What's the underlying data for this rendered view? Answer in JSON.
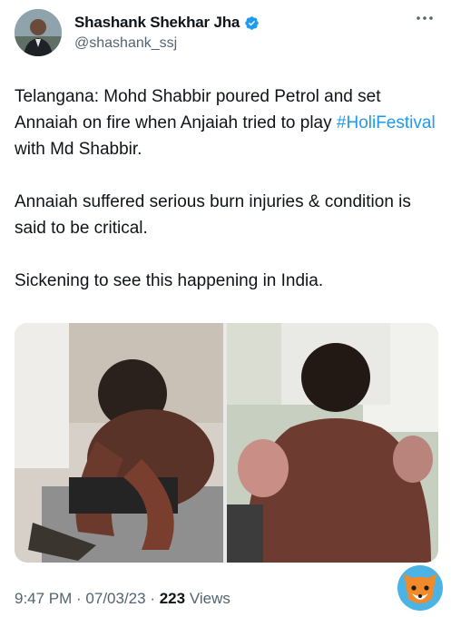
{
  "author": {
    "display_name": "Shashank Shekhar Jha",
    "handle": "@shashank_ssj",
    "avatar_icon": "profile-avatar",
    "verified_icon": "verified-badge-icon",
    "verified_color": "#1d9bf0"
  },
  "more_icon": "more-dots-icon",
  "tweet": {
    "line1_prefix": "Telangana: Mohd Shabbir poured Petrol and set Annaiah on fire when Anjaiah tried to play ",
    "hashtag": "#HoliFestival",
    "line1_suffix": " with Md Shabbir.",
    "paragraph2": "Annaiah suffered serious burn injuries & condition is said to be critical.",
    "paragraph3": "Sickening to see this happening in India."
  },
  "meta": {
    "time": "9:47 PM",
    "separator": " · ",
    "date": "07/03/23",
    "views_count": "223",
    "views_label": " Views"
  },
  "colors": {
    "link": "#1d9bf0",
    "secondary_text": "#536471",
    "primary_text": "#0f1419"
  }
}
